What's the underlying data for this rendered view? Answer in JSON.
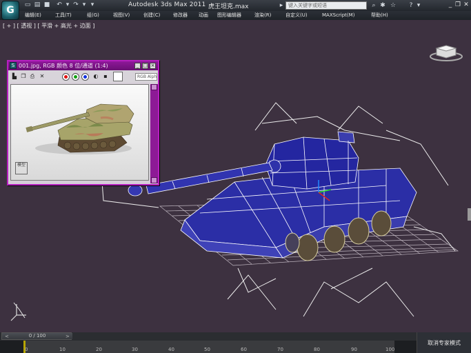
{
  "title_bar": {
    "app_title": "Autodesk 3ds Max  2011",
    "file_name": "虎王坦克.max",
    "search_placeholder": "键入关键字或短语",
    "logo_letter": "G"
  },
  "menu": {
    "items": [
      "编辑(E)",
      "工具(T)",
      "组(G)",
      "视图(V)",
      "创建(C)",
      "修改器",
      "动画",
      "图形编辑器",
      "渲染(R)",
      "自定义(U)",
      "MAXScript(M)",
      "帮助(H)"
    ]
  },
  "viewport": {
    "label": "[ + ] [ 透视 ] [ 平滑 + 高光 + 边面 ]",
    "model_name": "King Tiger tank wireframe"
  },
  "image_window": {
    "title": "001.jpg, RGB 颜色 8 位/通道 (1:4)",
    "channel_select": "RGB Alpha",
    "photo_logo": "模型"
  },
  "timeline": {
    "slider_label": "0 / 100",
    "prev_label": "<",
    "next_label": ">",
    "ticks": [
      "0",
      "10",
      "20",
      "30",
      "40",
      "50",
      "60",
      "70",
      "80",
      "90",
      "100"
    ],
    "expert_button": "取消专家模式",
    "frame_current": 0,
    "frame_total": 100
  },
  "colors": {
    "accent_magenta": "#b61fbf",
    "viewport_bg": "#3d3140",
    "model_blue": "#2b2ea6"
  }
}
